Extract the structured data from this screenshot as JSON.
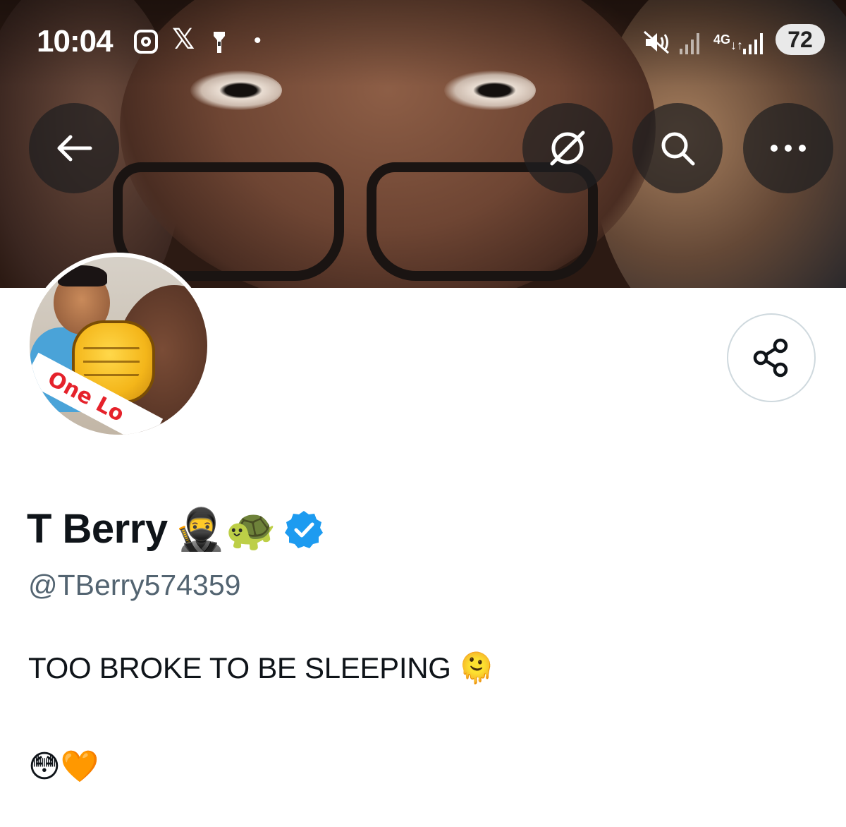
{
  "status_bar": {
    "time": "10:04",
    "network": "4G",
    "battery": "72",
    "icons": [
      "instagram-icon",
      "x-logo-icon",
      "flashlight-icon",
      "dot-icon",
      "mute-icon",
      "signal-icon",
      "signal-icon"
    ]
  },
  "header": {
    "buttons": [
      "back-arrow-icon",
      "grok-icon",
      "search-icon",
      "more-icon"
    ]
  },
  "profile": {
    "display_name": "T Berry",
    "name_emojis": "🥷🐢",
    "verified": true,
    "verified_color": "#1d9bf0",
    "handle": "@TBerry574359",
    "bio_line1": "TOO BROKE TO BE SLEEPING",
    "bio_line1_emoji": "🫠",
    "bio_line2_emojis": "😳🧡",
    "avatar_text": "One Lo"
  },
  "colors": {
    "accent": "#1d9bf0",
    "text_primary": "#0f1419",
    "text_secondary": "#536471",
    "border": "#cfd9de"
  }
}
